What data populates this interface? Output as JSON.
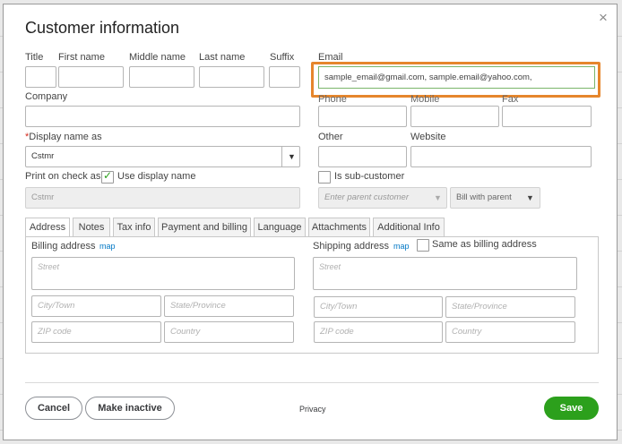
{
  "dialog": {
    "title": "Customer information",
    "close_glyph": "×"
  },
  "name": {
    "title_label": "Title",
    "first_label": "First name",
    "middle_label": "Middle name",
    "last_label": "Last name",
    "suffix_label": "Suffix"
  },
  "email": {
    "label": "Email",
    "value": "sample_email@gmail.com, sample.email@yahoo.com,"
  },
  "company": {
    "label": "Company"
  },
  "phones": {
    "phone_label": "Phone",
    "mobile_label": "Mobile",
    "fax_label": "Fax"
  },
  "display_name": {
    "required_mark": "*",
    "label": "Display name as",
    "value": "Cstmr"
  },
  "other": {
    "label": "Other"
  },
  "website": {
    "label": "Website"
  },
  "print_on_check": {
    "label": "Print on check as",
    "use_display_label": "Use display name",
    "use_display_checked": true,
    "value": "Cstmr"
  },
  "sub_customer": {
    "label": "Is sub-customer",
    "checked": false,
    "parent_placeholder": "Enter parent customer",
    "bill_with_parent": "Bill with parent"
  },
  "tabs": [
    {
      "label": "Address",
      "active": true
    },
    {
      "label": "Notes",
      "active": false
    },
    {
      "label": "Tax info",
      "active": false
    },
    {
      "label": "Payment and billing",
      "active": false
    },
    {
      "label": "Language",
      "active": false
    },
    {
      "label": "Attachments",
      "active": false
    },
    {
      "label": "Additional Info",
      "active": false
    }
  ],
  "billing": {
    "label": "Billing address",
    "map": "map",
    "street": "Street",
    "city": "City/Town",
    "state": "State/Province",
    "zip": "ZIP code",
    "country": "Country"
  },
  "shipping": {
    "label": "Shipping address",
    "map": "map",
    "same_as_billing": "Same as billing address",
    "same_checked": false,
    "street": "Street",
    "city": "City/Town",
    "state": "State/Province",
    "zip": "ZIP code",
    "country": "Country"
  },
  "footer": {
    "cancel": "Cancel",
    "make_inactive": "Make inactive",
    "privacy": "Privacy",
    "save": "Save"
  },
  "colors": {
    "accent_green": "#2ca01c",
    "highlight_orange": "#e6862c",
    "link_blue": "#0077c5",
    "required_red": "#d52b1e"
  },
  "icons": {
    "close": "close-icon",
    "dropdown": "chevron-down-icon",
    "check": "checkmark-icon"
  }
}
